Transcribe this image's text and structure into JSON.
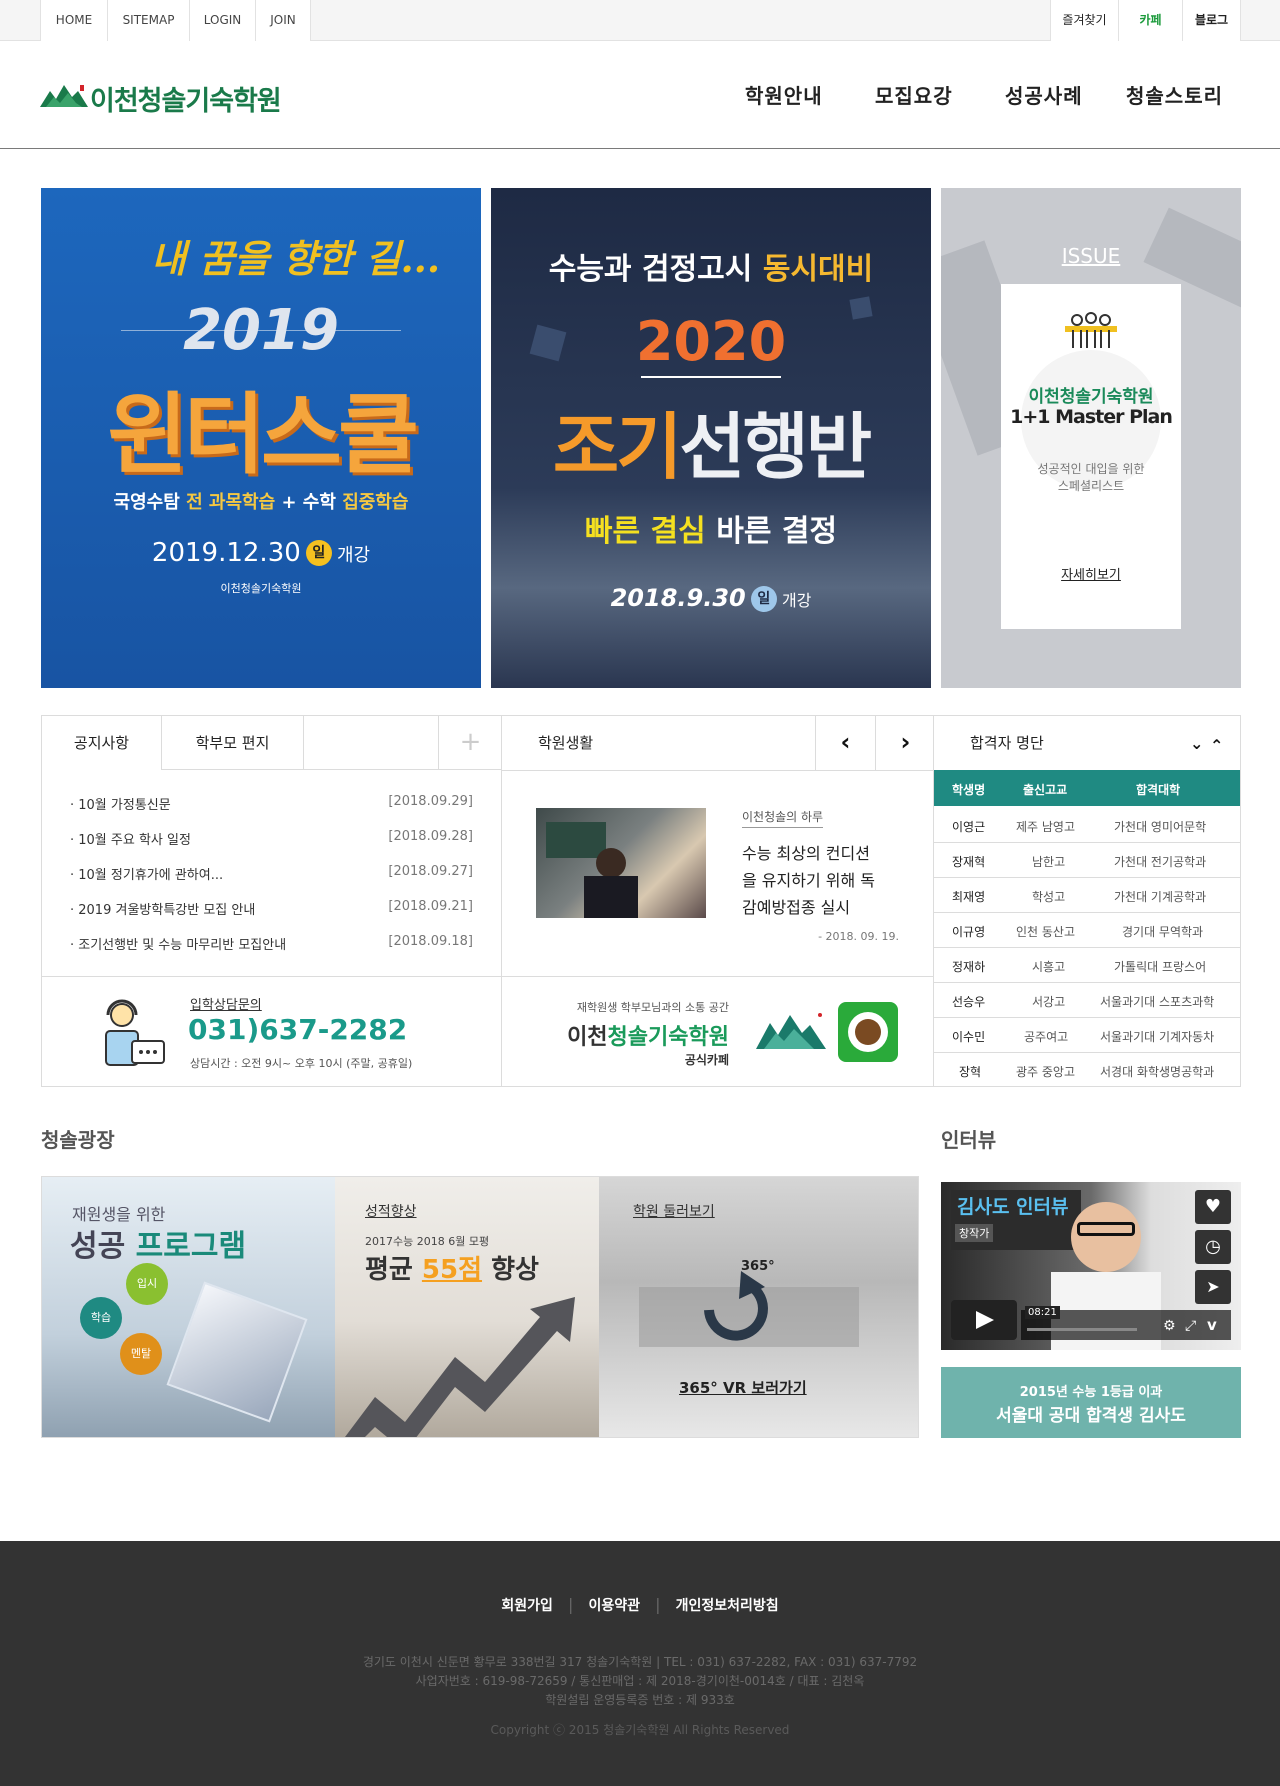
{
  "topbar": {
    "left_links": [
      "HOME",
      "SITEMAP",
      "LOGIN",
      "JOIN"
    ],
    "right_links": [
      "즐겨찾기",
      "카페",
      "블로그"
    ]
  },
  "header": {
    "logo_text": "이천청솔기숙학원",
    "nav": [
      "학원안내",
      "모집요강",
      "성공사례",
      "청솔스토리"
    ]
  },
  "banners": {
    "winter": {
      "script": "내 꿈을 향한 길...",
      "year": "2019",
      "title": "윈터스쿨",
      "subtitle_a": "국영수탐",
      "subtitle_b": "전 과목학습",
      "subtitle_c": "+ 수학",
      "subtitle_d": "집중학습",
      "date": "2019.12.30",
      "day": "일",
      "open": "개강",
      "org": "이천청솔기숙학원"
    },
    "early": {
      "top_a": "수능과 검정고시",
      "top_b": "동시대비",
      "year": "2020",
      "title_a": "조기",
      "title_b": "선행반",
      "slogan_a": "빠른 결심",
      "slogan_b": "바른 결정",
      "date": "2018.9.30",
      "day": "일",
      "open": "개강"
    },
    "issue": {
      "label": "ISSUE",
      "org": "이천청솔기숙학원",
      "plan": "1+1 Master Plan",
      "desc1": "성공적인 대입을 위한",
      "desc2": "스페셜리스트",
      "more": "자세히보기"
    }
  },
  "notice": {
    "tabs": [
      "공지사항",
      "학부모 편지"
    ],
    "plus": "+",
    "items": [
      {
        "title": "10월 가정통신문",
        "date": "[2018.09.29]"
      },
      {
        "title": "10월 주요 학사 일정",
        "date": "[2018.09.28]"
      },
      {
        "title": "10월 정기휴가에 관하여...",
        "date": "[2018.09.27]"
      },
      {
        "title": "2019 겨울방학특강반 모집 안내",
        "date": "[2018.09.21]"
      },
      {
        "title": "조기선행반 및 수능 마무리반 모집안내",
        "date": "[2018.09.18]"
      }
    ]
  },
  "life": {
    "title": "학원생활",
    "category": "이천청솔의 하루",
    "headline": "수능 최상의 컨디션을 유지하기 위해 독감예방접종 실시",
    "headline_l1": "수능 최상의 컨디션",
    "headline_l2": "을 유지하기 위해 독",
    "headline_l3": "감예방접종 실시",
    "date": "- 2018. 09. 19."
  },
  "consult": {
    "label": "입학상담문의",
    "phone": "031)637-2282",
    "hours": "상담시간 : 오전 9시~ 오후 10시 (주말, 공휴일)"
  },
  "cafe": {
    "sub": "재학원생 학부모님과의 소통 공간",
    "name_a": "이천",
    "name_b": "청솔기숙학원",
    "label": "공식카페"
  },
  "passers": {
    "title": "합격자 명단",
    "headers": [
      "학생명",
      "출신고교",
      "합격대학"
    ],
    "rows": [
      [
        "이영근",
        "제주 남영고",
        "가천대 영미어문학"
      ],
      [
        "장재혁",
        "남한고",
        "가천대 전기공학과"
      ],
      [
        "최재영",
        "학성고",
        "가천대 기계공학과"
      ],
      [
        "이규영",
        "인천 동산고",
        "경기대 무역학과"
      ],
      [
        "정재하",
        "시흥고",
        "가톨릭대 프랑스어"
      ],
      [
        "선승우",
        "서강고",
        "서울과기대 스포츠과학"
      ],
      [
        "이수민",
        "공주여고",
        "서울과기대 기계자동차"
      ],
      [
        "장혁",
        "광주 중앙고",
        "서경대 화학생명공학과"
      ]
    ]
  },
  "plaza": {
    "title": "청솔광장",
    "p1": {
      "small": "재원생을 위한",
      "big_a": "성공",
      "big_b": "프로그램",
      "c1": "입시",
      "c2": "학습",
      "c3": "멘탈"
    },
    "p2": {
      "label": "성적향상",
      "small": "2017수능 2018 6월 모평",
      "big_a": "평균",
      "big_b": "55점",
      "big_c": "향상"
    },
    "p3": {
      "label": "학원 둘러보기",
      "deg": "365°",
      "cta": "365° VR 보러가기"
    }
  },
  "interview": {
    "title": "인터뷰",
    "video_title": "김사도 인터뷰",
    "channel": "창작가",
    "time": "08:21",
    "cap_small": "2015년 수능 1등급 이과",
    "cap_big": "서울대 공대 합격생 김사도"
  },
  "footer": {
    "links": [
      "회원가입",
      "이용약관",
      "개인정보처리방침"
    ],
    "line1": "경기도 이천시 신둔면 황무로 338번길 317 청솔기숙학원  |  TEL : 031) 637-2282, FAX : 031) 637-7792",
    "line2": "사업자번호 : 619-98-72659 / 통신판매업 : 제 2018-경기이천-0014호 / 대표 : 김천옥",
    "line3": "학원설립 운영등록증 번호 : 제 933호",
    "copyright": "Copyright ⓒ 2015 청솔기숙학원 All Rights Reserved"
  },
  "colors": {
    "brand_green": "#1a8a5a",
    "teal": "#1f8a82",
    "footer_bg": "#333333",
    "winter_blue": "#1a5fb0",
    "issue_gray": "#c8cacf"
  }
}
